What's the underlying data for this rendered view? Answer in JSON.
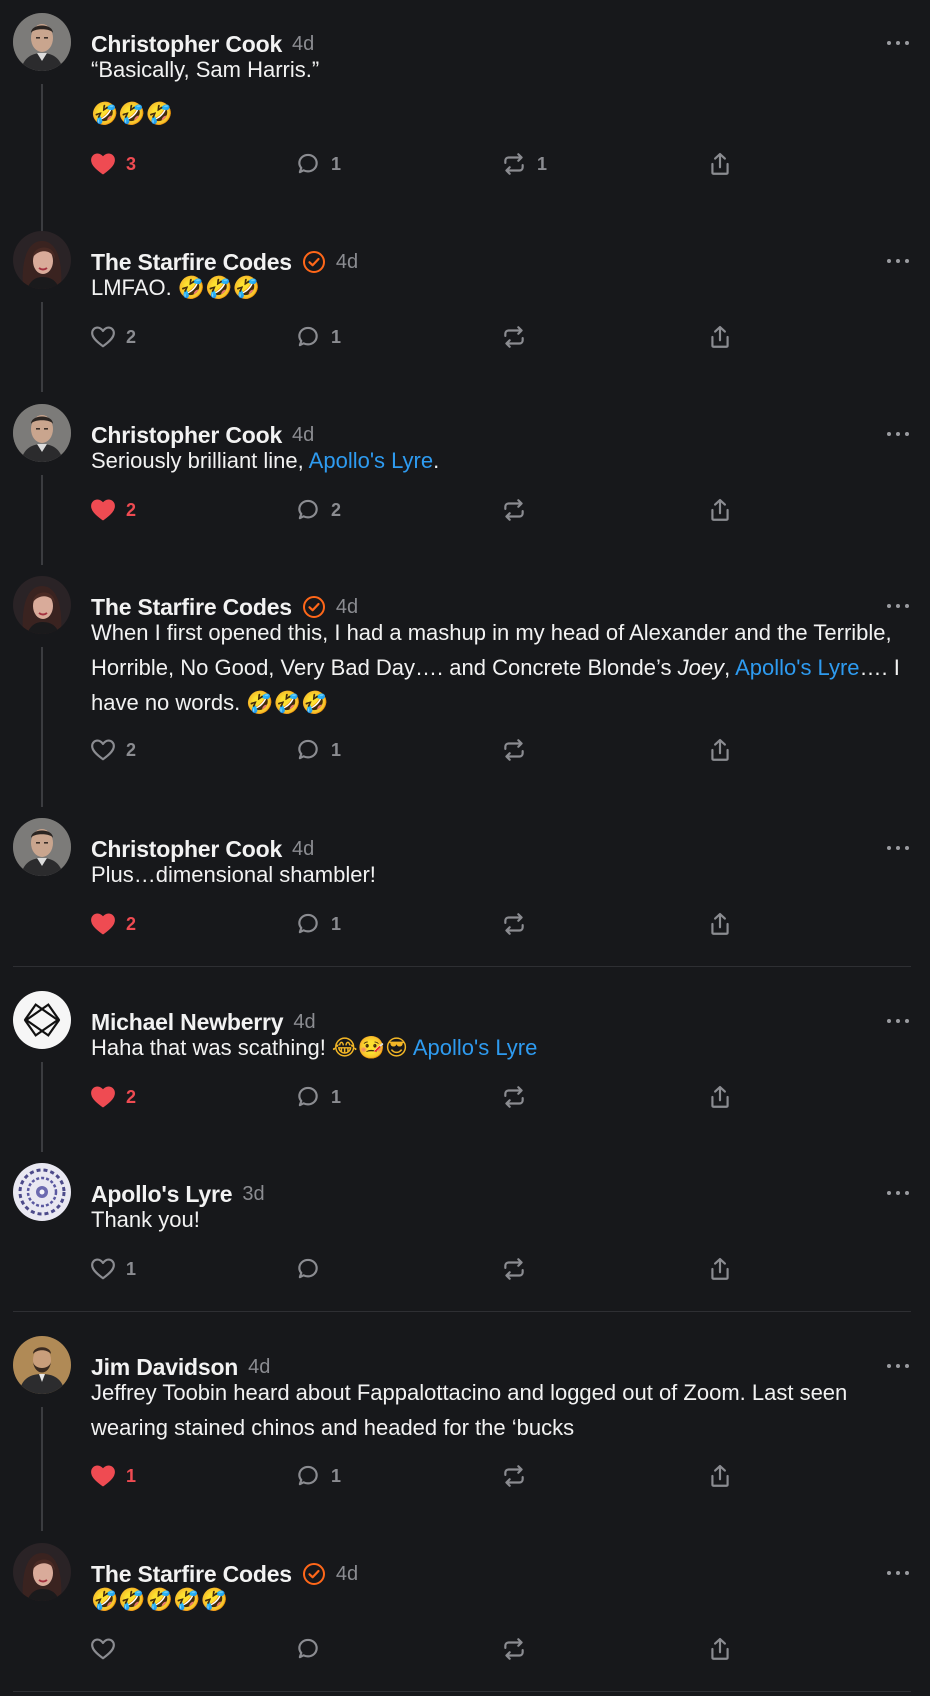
{
  "colors": {
    "background": "#17181b",
    "text": "#f2f2f2",
    "muted": "#8b8c91",
    "liked": "#ef4b52",
    "mention": "#2e9bf0",
    "verified": "#ff6719",
    "divider": "#2e2f33"
  },
  "comments": [
    {
      "author": "Christopher Cook",
      "time": "4d",
      "verified": false,
      "avatar": "avatar-christopher",
      "text_plain": "“Basically, Sam Harris.”",
      "text_emoji": "🤣🤣🤣",
      "likes": "3",
      "liked": true,
      "replies": "1",
      "restacks": "1"
    },
    {
      "author": "The Starfire Codes",
      "time": "4d",
      "verified": true,
      "avatar": "avatar-starfire",
      "text_plain": "LMFAO. ",
      "text_emoji": "🤣🤣🤣",
      "likes": "2",
      "liked": false,
      "replies": "1",
      "restacks": ""
    },
    {
      "author": "Christopher Cook",
      "time": "4d",
      "verified": false,
      "avatar": "avatar-christopher",
      "text_plain": "Seriously brilliant line, ",
      "mention": "Apollo's Lyre",
      "text_after": ".",
      "likes": "2",
      "liked": true,
      "replies": "2",
      "restacks": ""
    },
    {
      "author": "The Starfire Codes",
      "time": "4d",
      "verified": true,
      "avatar": "avatar-starfire",
      "text_plain": "When I first opened this, I had a mashup in my head of Alexander and the Terrible, Horrible, No Good, Very Bad Day…. and Concrete Blonde’s ",
      "text_italic": "Joey",
      "text_comma": ",",
      "mention": "Apollo's Lyre",
      "text_after": "…. I have no words. ",
      "text_emoji": "🤣🤣🤣",
      "likes": "2",
      "liked": false,
      "replies": "1",
      "restacks": ""
    },
    {
      "author": "Christopher Cook",
      "time": "4d",
      "verified": false,
      "avatar": "avatar-christopher",
      "text_plain": "Plus…dimensional shambler!",
      "likes": "2",
      "liked": true,
      "replies": "1",
      "restacks": ""
    },
    {
      "author": "Michael Newberry",
      "time": "4d",
      "verified": false,
      "avatar": "avatar-newberry",
      "text_plain": "Haha that was scathing! ",
      "text_emoji": "😂🤒😎",
      "mention": "Apollo's Lyre",
      "likes": "2",
      "liked": true,
      "replies": "1",
      "restacks": ""
    },
    {
      "author": "Apollo's Lyre",
      "time": "3d",
      "verified": false,
      "avatar": "avatar-apollo",
      "text_plain": "Thank you!",
      "likes": "1",
      "liked": false,
      "replies": "",
      "restacks": ""
    },
    {
      "author": "Jim Davidson",
      "time": "4d",
      "verified": false,
      "avatar": "avatar-jim",
      "text_plain": "Jeffrey Toobin heard about Fappalottacino and logged out of Zoom. Last seen wearing stained chinos and headed for the ‘bucks",
      "likes": "1",
      "liked": true,
      "replies": "1",
      "restacks": ""
    },
    {
      "author": "The Starfire Codes",
      "time": "4d",
      "verified": true,
      "avatar": "avatar-starfire",
      "text_emoji": "🤣🤣🤣🤣🤣",
      "likes": "",
      "liked": false,
      "replies": "",
      "restacks": ""
    }
  ]
}
